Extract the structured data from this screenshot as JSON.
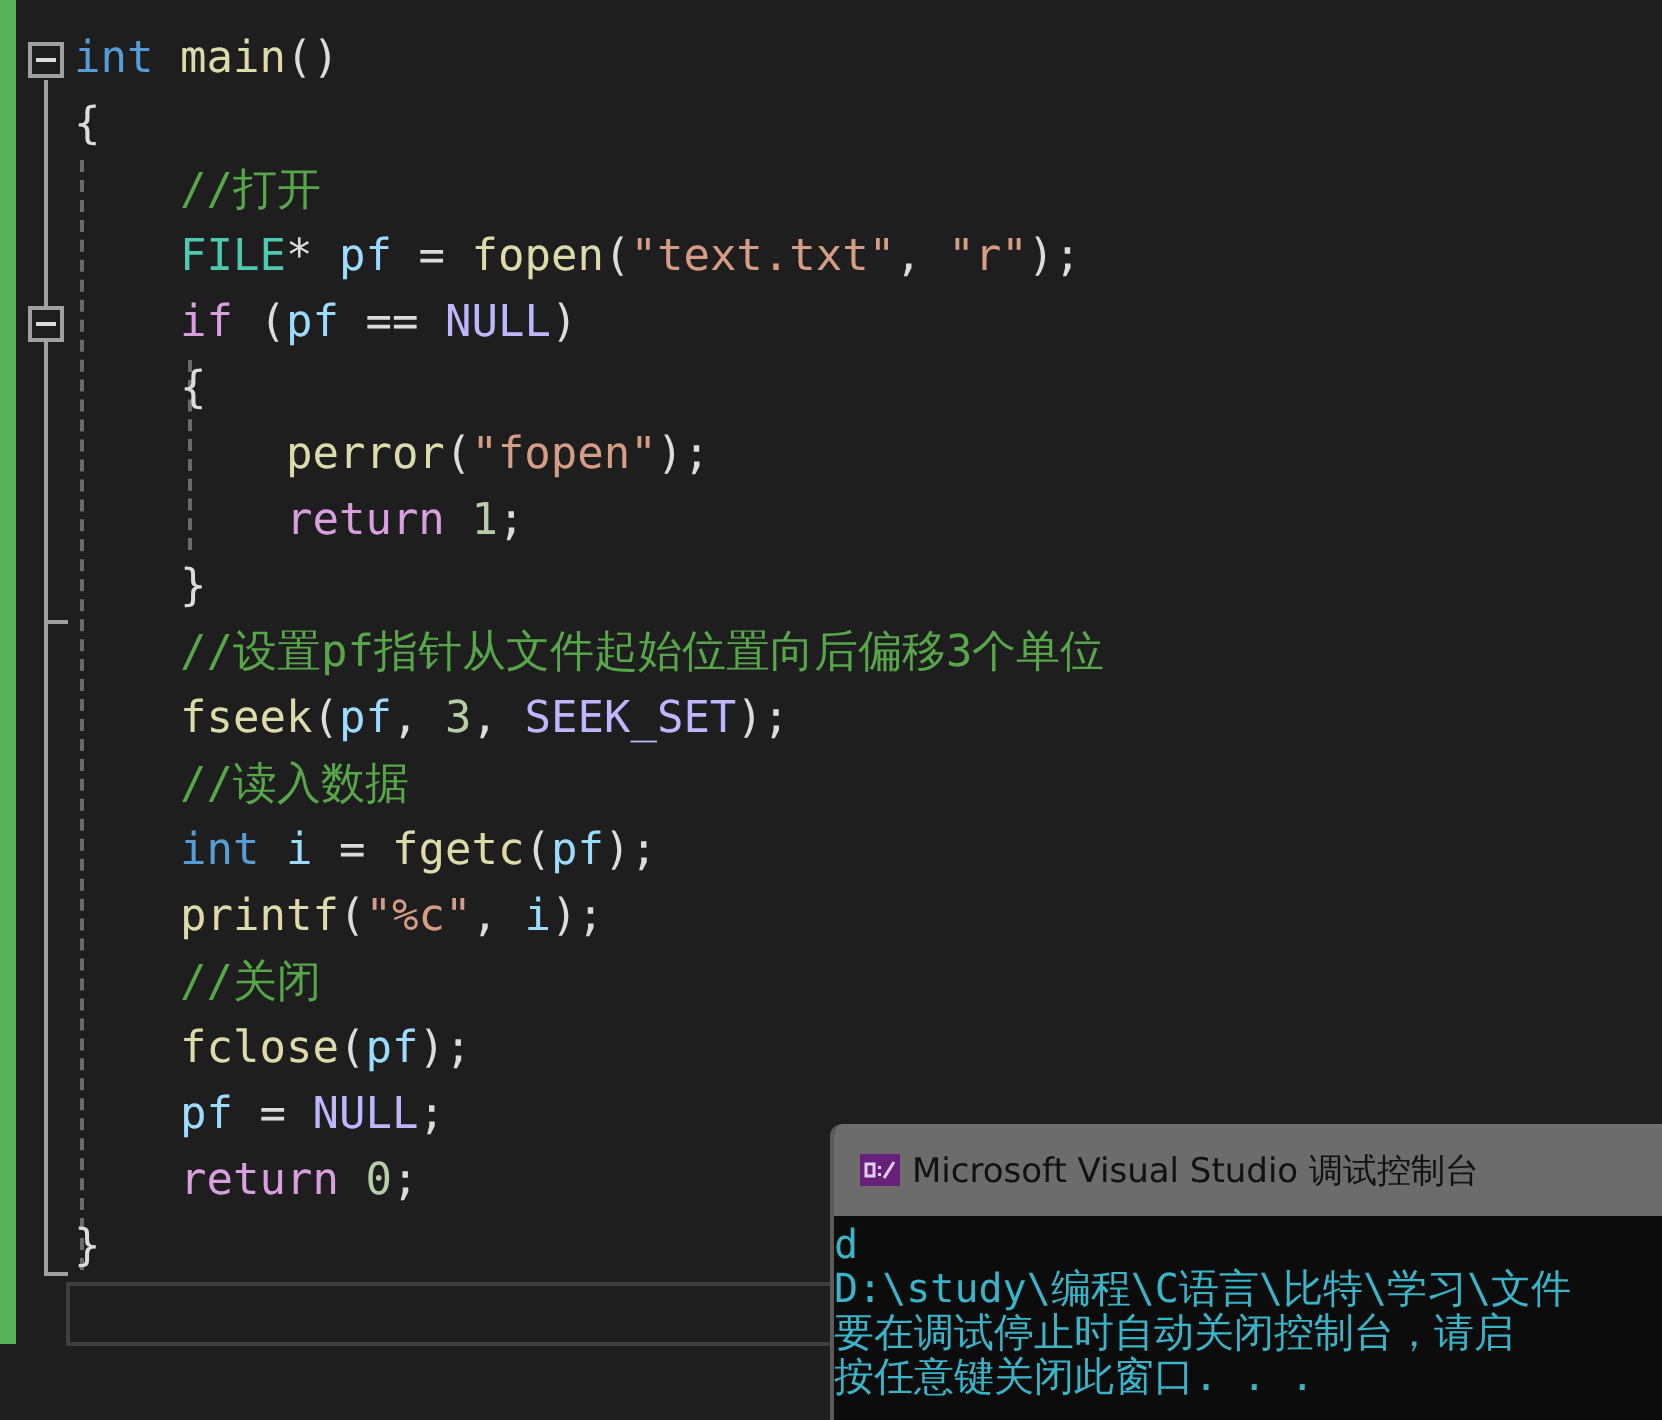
{
  "editor": {
    "lines": [
      {
        "collapsible": true,
        "tokens": [
          {
            "t": "int ",
            "kind": "keyword"
          },
          {
            "t": "main",
            "kind": "func"
          },
          {
            "t": "()",
            "kind": "plain"
          }
        ]
      },
      {
        "collapsible": false,
        "tokens": [
          {
            "t": "{",
            "kind": "plain"
          }
        ]
      },
      {
        "collapsible": false,
        "tokens": [
          {
            "t": "    //打开",
            "kind": "comment"
          }
        ]
      },
      {
        "collapsible": false,
        "tokens": [
          {
            "t": "    FILE",
            "kind": "type"
          },
          {
            "t": "* ",
            "kind": "plain"
          },
          {
            "t": "pf",
            "kind": "var"
          },
          {
            "t": " = ",
            "kind": "plain"
          },
          {
            "t": "fopen",
            "kind": "func"
          },
          {
            "t": "(",
            "kind": "plain"
          },
          {
            "t": "\"text.txt\"",
            "kind": "string"
          },
          {
            "t": ", ",
            "kind": "plain"
          },
          {
            "t": "\"r\"",
            "kind": "string"
          },
          {
            "t": ");",
            "kind": "plain"
          }
        ]
      },
      {
        "collapsible": true,
        "tokens": [
          {
            "t": "    if",
            "kind": "control"
          },
          {
            "t": " (",
            "kind": "plain"
          },
          {
            "t": "pf",
            "kind": "var"
          },
          {
            "t": " == ",
            "kind": "plain"
          },
          {
            "t": "NULL",
            "kind": "macro"
          },
          {
            "t": ")",
            "kind": "plain"
          }
        ]
      },
      {
        "collapsible": false,
        "tokens": [
          {
            "t": "    {",
            "kind": "plain"
          }
        ]
      },
      {
        "collapsible": false,
        "tokens": [
          {
            "t": "        perror",
            "kind": "func"
          },
          {
            "t": "(",
            "kind": "plain"
          },
          {
            "t": "\"fopen\"",
            "kind": "string"
          },
          {
            "t": ");",
            "kind": "plain"
          }
        ]
      },
      {
        "collapsible": false,
        "tokens": [
          {
            "t": "        return ",
            "kind": "control"
          },
          {
            "t": "1",
            "kind": "number"
          },
          {
            "t": ";",
            "kind": "plain"
          }
        ]
      },
      {
        "collapsible": false,
        "tokens": [
          {
            "t": "    }",
            "kind": "plain"
          }
        ]
      },
      {
        "collapsible": false,
        "tokens": [
          {
            "t": "    //设置pf指针从文件起始位置向后偏移3个单位",
            "kind": "comment"
          }
        ]
      },
      {
        "collapsible": false,
        "tokens": [
          {
            "t": "    fseek",
            "kind": "func"
          },
          {
            "t": "(",
            "kind": "plain"
          },
          {
            "t": "pf",
            "kind": "var"
          },
          {
            "t": ", ",
            "kind": "plain"
          },
          {
            "t": "3",
            "kind": "number"
          },
          {
            "t": ", ",
            "kind": "plain"
          },
          {
            "t": "SEEK_SET",
            "kind": "macro"
          },
          {
            "t": ");",
            "kind": "plain"
          }
        ]
      },
      {
        "collapsible": false,
        "tokens": [
          {
            "t": "    //读入数据",
            "kind": "comment"
          }
        ]
      },
      {
        "collapsible": false,
        "tokens": [
          {
            "t": "    int ",
            "kind": "keyword"
          },
          {
            "t": "i",
            "kind": "var"
          },
          {
            "t": " = ",
            "kind": "plain"
          },
          {
            "t": "fgetc",
            "kind": "func"
          },
          {
            "t": "(",
            "kind": "plain"
          },
          {
            "t": "pf",
            "kind": "var"
          },
          {
            "t": ");",
            "kind": "plain"
          }
        ]
      },
      {
        "collapsible": false,
        "tokens": [
          {
            "t": "    printf",
            "kind": "func"
          },
          {
            "t": "(",
            "kind": "plain"
          },
          {
            "t": "\"%c\"",
            "kind": "string"
          },
          {
            "t": ", ",
            "kind": "plain"
          },
          {
            "t": "i",
            "kind": "var"
          },
          {
            "t": ");",
            "kind": "plain"
          }
        ]
      },
      {
        "collapsible": false,
        "tokens": [
          {
            "t": "    //关闭",
            "kind": "comment"
          }
        ]
      },
      {
        "collapsible": false,
        "tokens": [
          {
            "t": "    fclose",
            "kind": "func"
          },
          {
            "t": "(",
            "kind": "plain"
          },
          {
            "t": "pf",
            "kind": "var"
          },
          {
            "t": ");",
            "kind": "plain"
          }
        ]
      },
      {
        "collapsible": false,
        "tokens": [
          {
            "t": "    pf",
            "kind": "var"
          },
          {
            "t": " = ",
            "kind": "plain"
          },
          {
            "t": "NULL",
            "kind": "macro"
          },
          {
            "t": ";",
            "kind": "plain"
          }
        ]
      },
      {
        "collapsible": false,
        "tokens": [
          {
            "t": "    return ",
            "kind": "control"
          },
          {
            "t": "0",
            "kind": "number"
          },
          {
            "t": ";",
            "kind": "plain"
          }
        ]
      },
      {
        "collapsible": false,
        "tokens": [
          {
            "t": "}",
            "kind": "plain"
          }
        ]
      }
    ]
  },
  "console": {
    "title": "Microsoft Visual Studio 调试控制台",
    "lines": [
      "d",
      "D:\\study\\编程\\C语言\\比特\\学习\\文件",
      "要在调试停止时自动关闭控制台，请启",
      "按任意键关闭此窗口. . ."
    ]
  }
}
